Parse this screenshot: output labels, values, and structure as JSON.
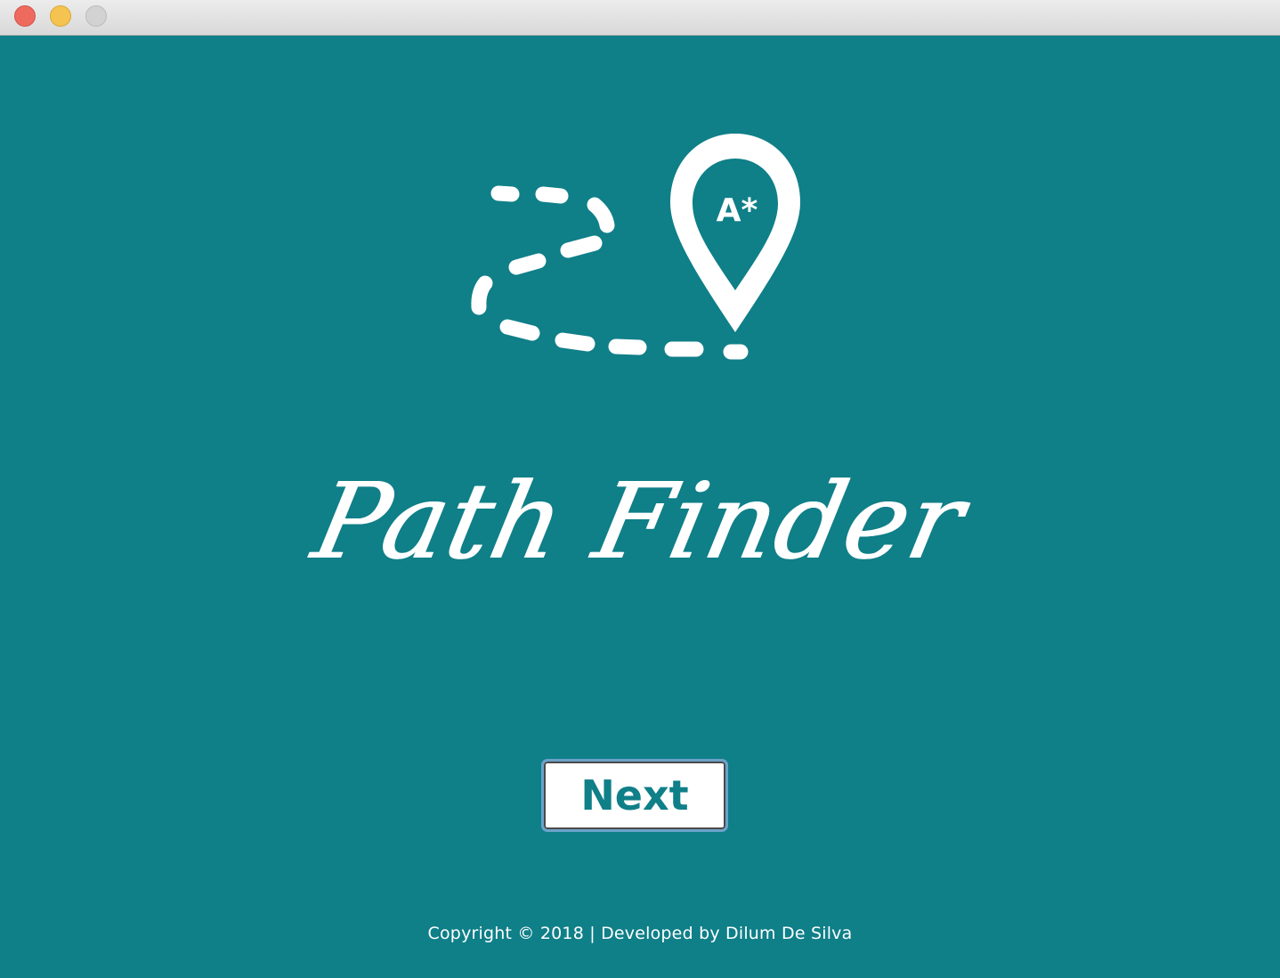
{
  "window": {
    "controls": {
      "close_icon": "close-icon",
      "minimize_icon": "minimize-icon",
      "maximize_icon": "maximize-icon"
    }
  },
  "logo": {
    "pin_label": "A*",
    "icons": [
      "dashed-path-icon",
      "map-pin-icon"
    ]
  },
  "app": {
    "title": "Path Finder"
  },
  "actions": {
    "next_label": "Next"
  },
  "footer": {
    "copyright": "Copyright © 2018 | Developed by Dilum De Silva"
  },
  "colors": {
    "background": "#0f7f88",
    "text": "#ffffff",
    "button_text": "#0f7f88",
    "button_border": "#6ba2c9"
  }
}
